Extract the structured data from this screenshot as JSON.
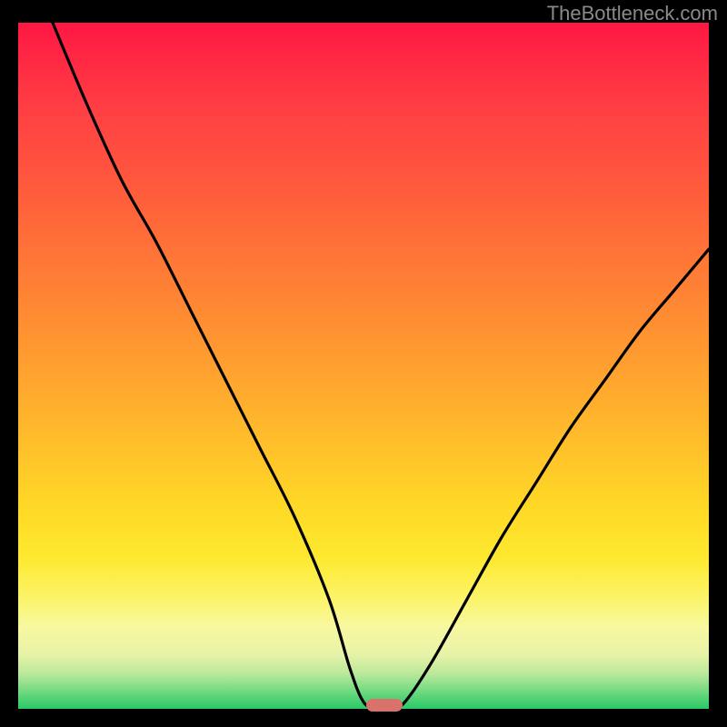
{
  "watermark": "TheBottleneck.com",
  "chart_data": {
    "type": "line",
    "title": "",
    "xlabel": "",
    "ylabel": "",
    "xlim": [
      0,
      100
    ],
    "ylim": [
      0,
      100
    ],
    "legend": false,
    "grid": false,
    "background_gradient": {
      "orientation": "vertical",
      "stops": [
        {
          "pos": 0.0,
          "color": "#ff1744"
        },
        {
          "pos": 0.5,
          "color": "#ffae2e"
        },
        {
          "pos": 0.8,
          "color": "#fee92f"
        },
        {
          "pos": 1.0,
          "color": "#29c968"
        }
      ]
    },
    "series": [
      {
        "name": "bottleneck-curve",
        "x": [
          5,
          10,
          15,
          20,
          25,
          30,
          35,
          40,
          45,
          48,
          50,
          52,
          54,
          56,
          60,
          65,
          70,
          75,
          80,
          85,
          90,
          95,
          100
        ],
        "y": [
          100,
          88,
          77,
          68,
          58,
          48,
          38,
          28,
          16,
          6,
          1,
          0,
          0,
          1,
          7,
          16,
          25,
          33,
          41,
          48,
          55,
          61,
          67
        ]
      }
    ],
    "marker": {
      "x": 53,
      "y": 0,
      "color": "#d9726b",
      "shape": "pill"
    }
  }
}
